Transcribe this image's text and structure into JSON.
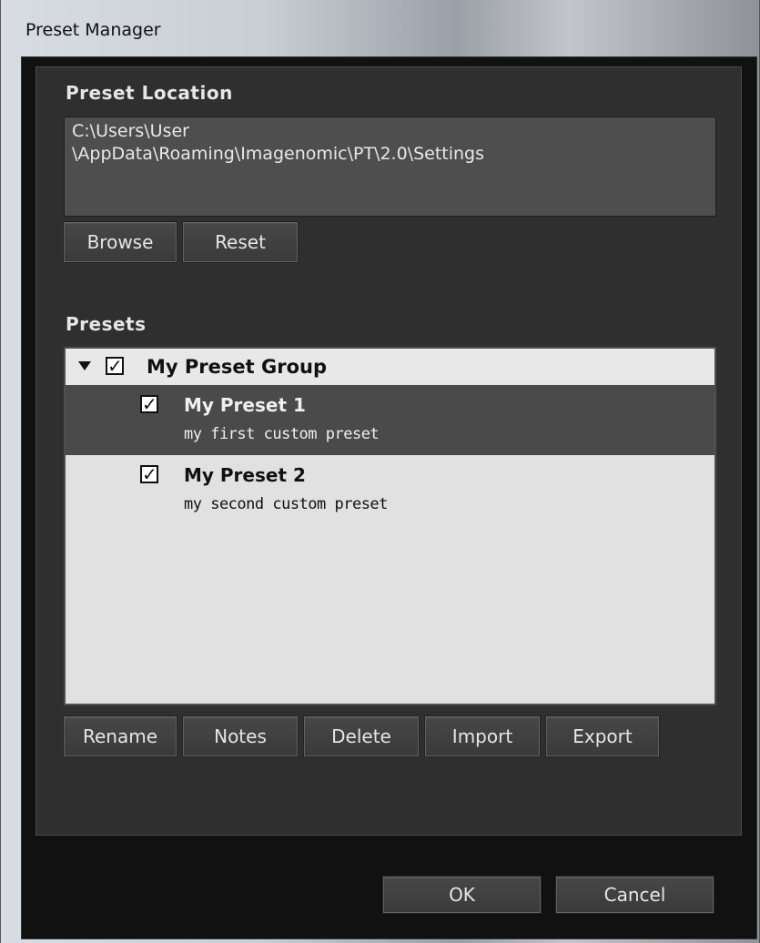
{
  "window": {
    "title": "Preset Manager"
  },
  "location": {
    "label": "Preset Location",
    "path_line1": "C:\\Users\\User",
    "path_line2": "\\AppData\\Roaming\\Imagenomic\\PT\\2.0\\Settings",
    "browse_label": "Browse",
    "reset_label": "Reset"
  },
  "presets": {
    "label": "Presets",
    "group": {
      "name": "My Preset Group",
      "checked": true,
      "expanded": true
    },
    "items": [
      {
        "title": "My Preset 1",
        "note": "my first custom preset",
        "checked": true,
        "selected": true
      },
      {
        "title": "My Preset 2",
        "note": "my second custom preset",
        "checked": true,
        "selected": false
      }
    ],
    "actions": {
      "rename": "Rename",
      "notes": "Notes",
      "delete": "Delete",
      "import": "Import",
      "export": "Export"
    }
  },
  "footer": {
    "ok": "OK",
    "cancel": "Cancel"
  },
  "icons": {
    "expand": "triangle-down-icon",
    "check": "checkmark-icon"
  }
}
